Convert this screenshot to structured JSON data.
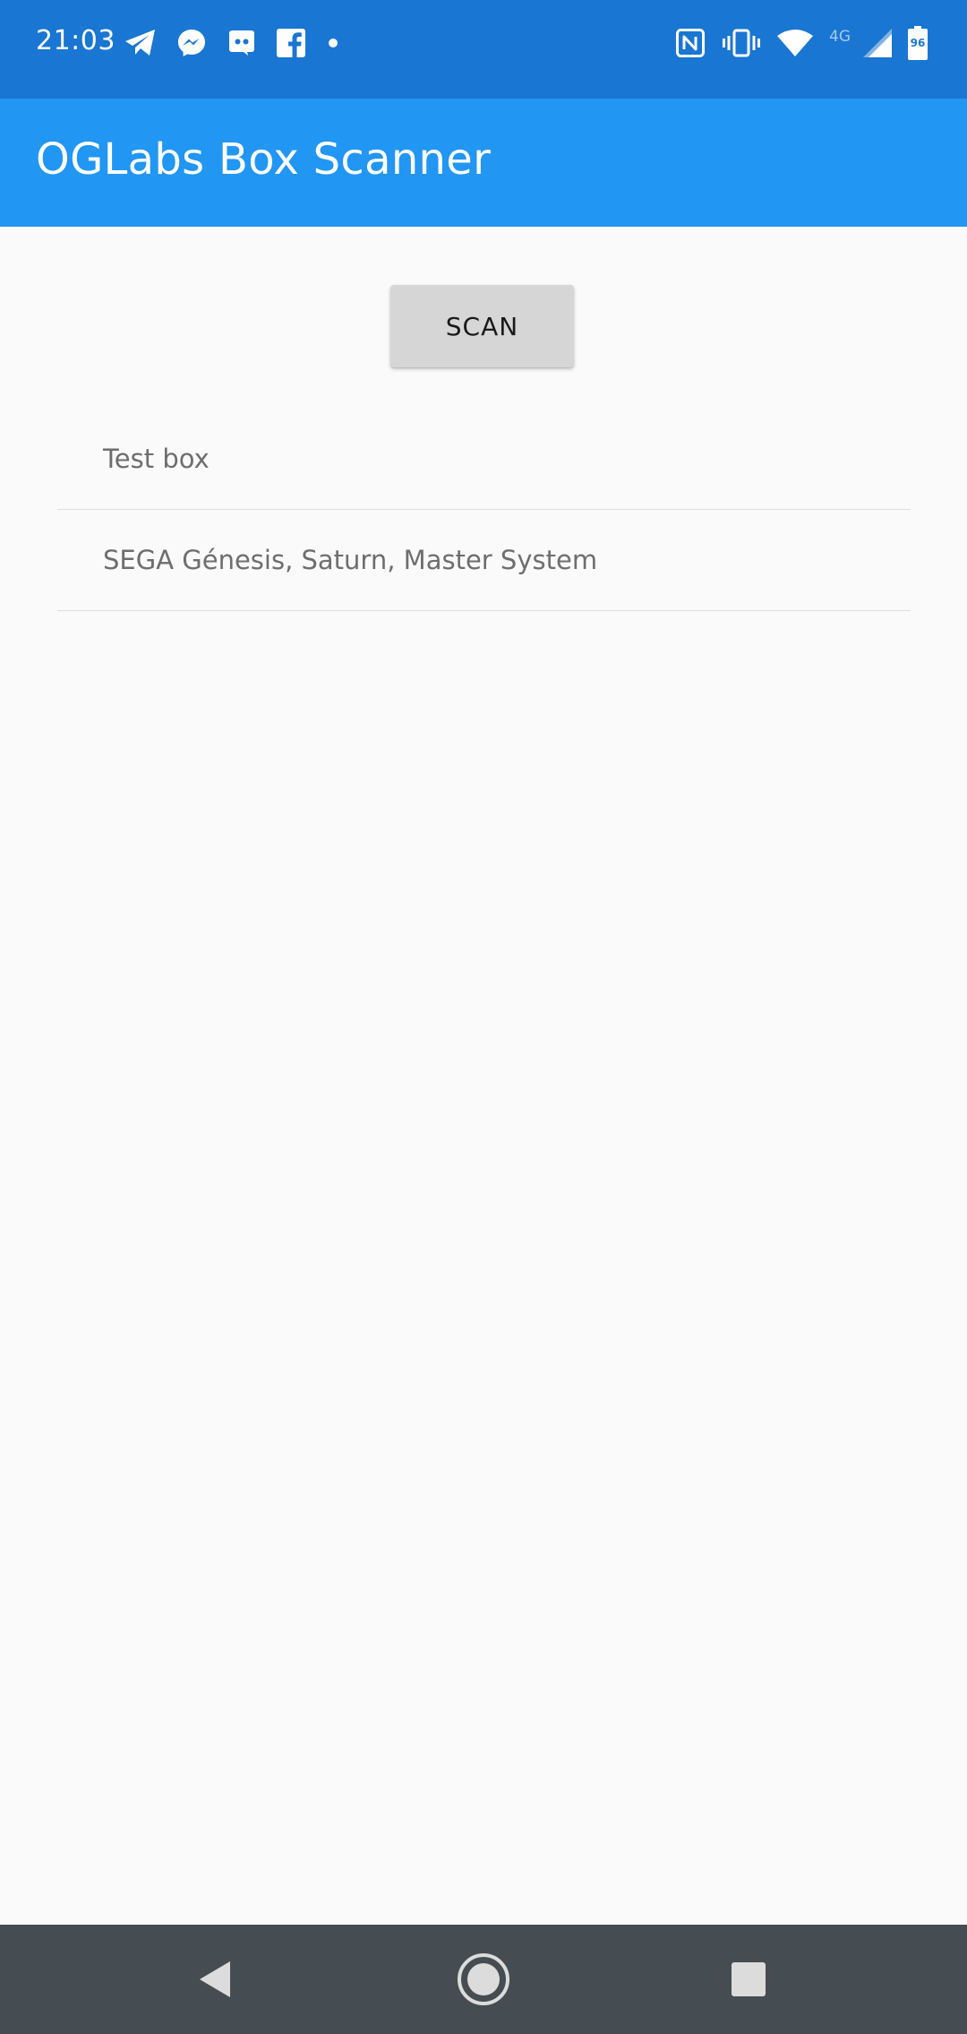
{
  "status_bar": {
    "time": "21:03",
    "notification_icons": [
      "telegram-icon",
      "messenger-icon",
      "discord-icon",
      "facebook-icon",
      "more-notifications-dot-icon"
    ],
    "system_icons": [
      "nfc-icon",
      "vibrate-icon",
      "wifi-icon",
      "cell-signal-icon",
      "battery-icon"
    ],
    "network_type": "4G",
    "battery_level": "96",
    "background_color": "#1976D2"
  },
  "app_bar": {
    "title": "OGLabs Box Scanner",
    "background_color": "#2196F3"
  },
  "main": {
    "scan_button_label": "SCAN",
    "boxes": [
      {
        "label": "Test box"
      },
      {
        "label": "SEGA Génesis, Saturn, Master System"
      }
    ]
  },
  "nav_bar": {
    "buttons": [
      "back-icon",
      "home-icon",
      "recents-icon"
    ],
    "background_color": "#464D52"
  }
}
